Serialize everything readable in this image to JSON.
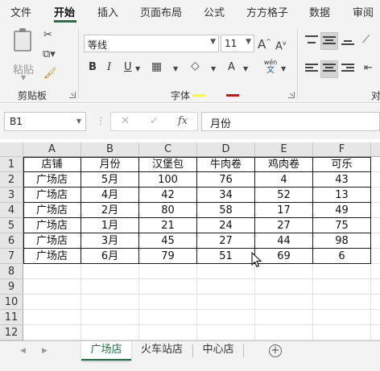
{
  "ribbon_tabs": [
    "文件",
    "开始",
    "插入",
    "页面布局",
    "公式",
    "方方格子",
    "数据",
    "审阅"
  ],
  "active_tab": "开始",
  "accent_color": "#217346",
  "clipboard": {
    "paste_label": "粘贴",
    "group_label": "剪贴板",
    "icons": [
      "paste-icon",
      "cut-icon",
      "copy-icon",
      "format-painter-icon"
    ]
  },
  "font": {
    "group_label": "字体",
    "font_name": "等线",
    "font_size": "11",
    "bold": "B",
    "italic": "I",
    "underline": "U",
    "grow": "A",
    "shrink": "A",
    "font_color_glyph": "A",
    "phonetic_top": "wén",
    "phonetic_bottom": "文",
    "fill_color": "#ffff00",
    "font_color": "#ff0000"
  },
  "alignment": {
    "group_label_partial": "对"
  },
  "formula_bar": {
    "name_box": "B1",
    "cancel": "✕",
    "confirm": "✓",
    "fx": "fx",
    "content": "月份"
  },
  "columns": [
    "A",
    "B",
    "C",
    "D",
    "E",
    "F"
  ],
  "rows": [
    "1",
    "2",
    "3",
    "4",
    "5",
    "6",
    "7",
    "8",
    "9",
    "10",
    "11",
    "12"
  ],
  "table": {
    "headers": [
      "店铺",
      "月份",
      "汉堡包",
      "牛肉卷",
      "鸡肉卷",
      "可乐"
    ],
    "rows": [
      [
        "广场店",
        "5月",
        "100",
        "76",
        "4",
        "43"
      ],
      [
        "广场店",
        "4月",
        "42",
        "34",
        "52",
        "13"
      ],
      [
        "广场店",
        "2月",
        "80",
        "58",
        "17",
        "49"
      ],
      [
        "广场店",
        "1月",
        "21",
        "24",
        "27",
        "75"
      ],
      [
        "广场店",
        "3月",
        "45",
        "27",
        "44",
        "98"
      ],
      [
        "广场店",
        "6月",
        "79",
        "51",
        "69",
        "6"
      ]
    ]
  },
  "sheet_tabs": [
    "广场店",
    "火车站店",
    "中心店"
  ],
  "active_sheet": "广场店",
  "add_sheet": "+"
}
